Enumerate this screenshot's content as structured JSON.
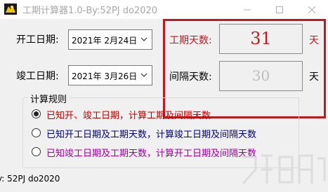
{
  "window": {
    "title": "工期计算器1.0-By:52PJ do2020"
  },
  "form": {
    "start_label": "开工日期:",
    "start_value": "2021年  2月24日",
    "end_label": "竣工日期:",
    "end_value": "2021年  3月26日"
  },
  "results": {
    "duration_label": "工期天数:",
    "duration_value": "31",
    "duration_unit": "天",
    "interval_label": "间隔天数:",
    "interval_value": "30",
    "interval_unit": "天"
  },
  "rules": {
    "title": "计算规则",
    "options": [
      {
        "label": "已知开、竣工日期，计算工期及间隔天数",
        "selected": true,
        "color": "#c00000"
      },
      {
        "label": "已知开工日期及工期天数，计算竣工日期及间隔天数",
        "selected": false,
        "color": "#000080"
      },
      {
        "label": "已知竣工日期及工期天数，计算开工日期及间隔天数",
        "selected": false,
        "color": "#a000a0"
      }
    ]
  },
  "status": {
    "text": "y: 52PJ  do2020"
  },
  "colors": {
    "accent_red": "#c0191f",
    "duration_text": "#c0191f",
    "interval_text": "#bdbdbd"
  }
}
